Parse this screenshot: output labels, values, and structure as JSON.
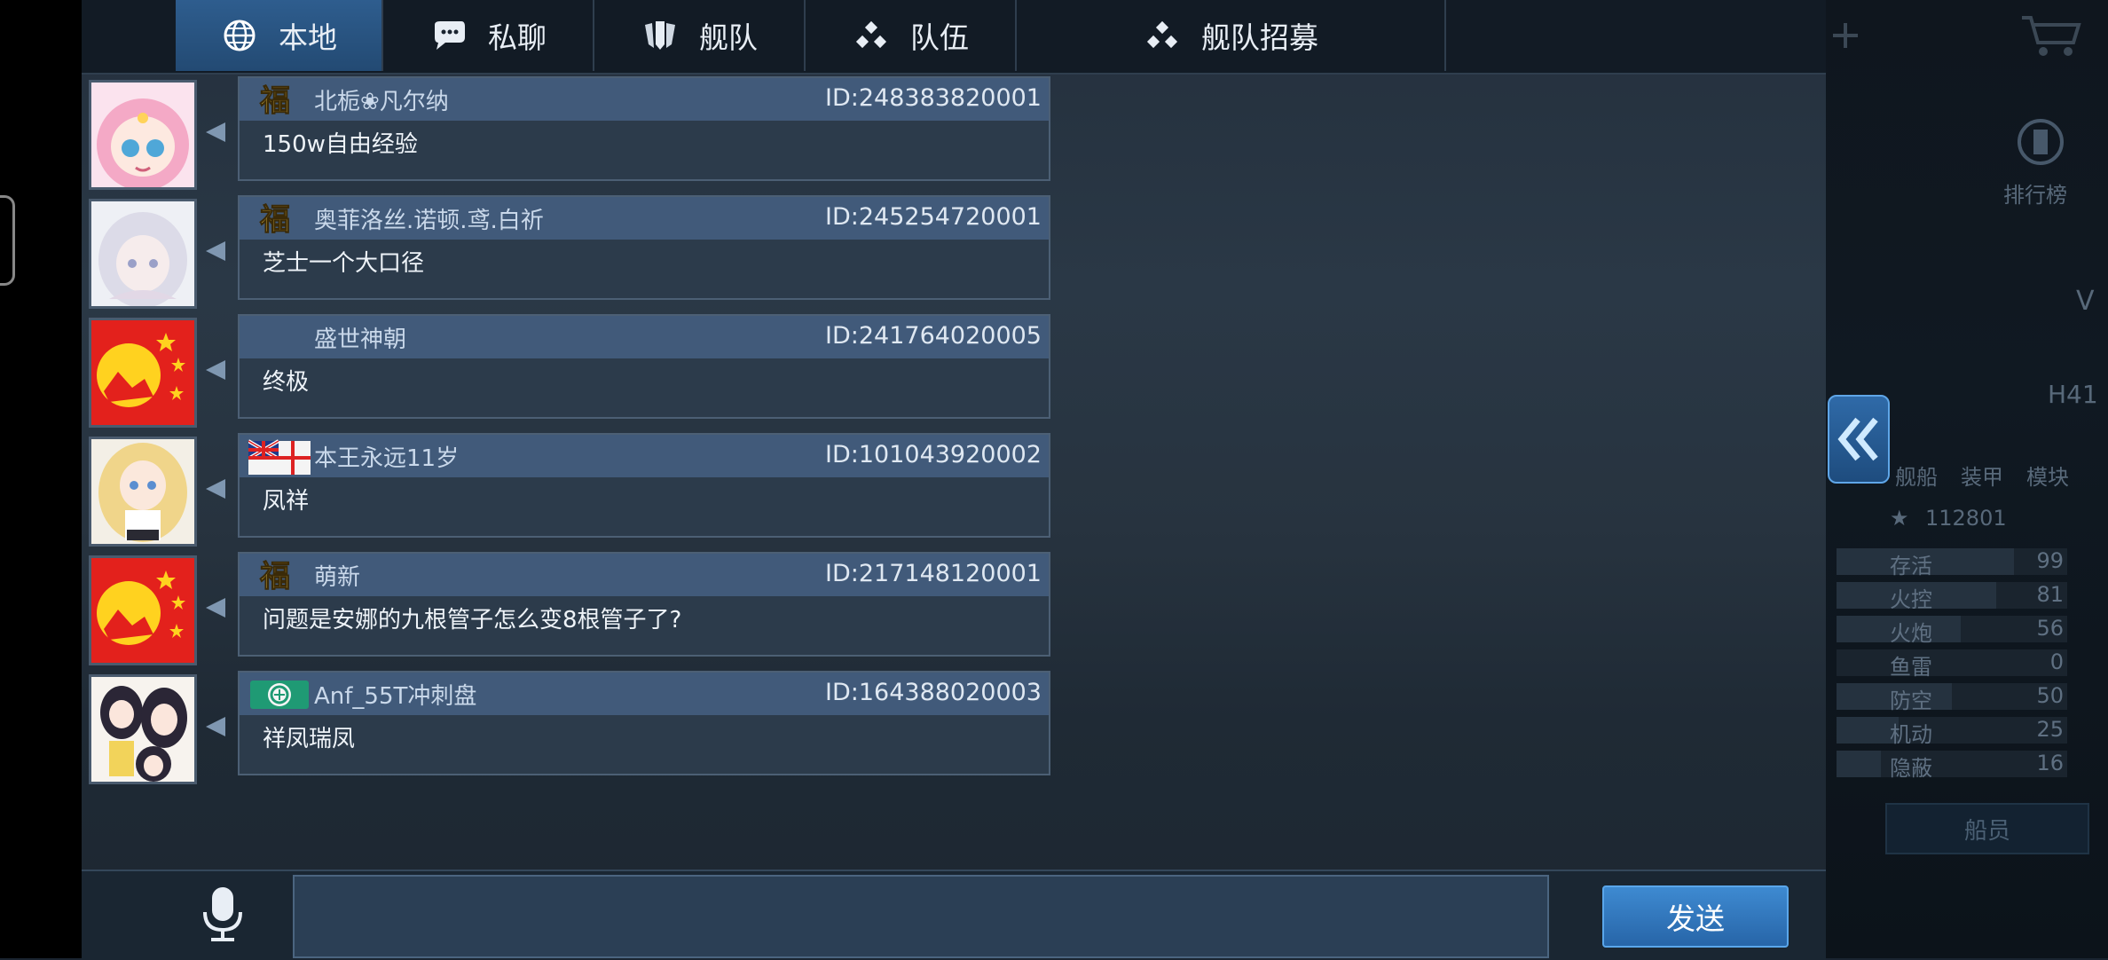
{
  "tabs": [
    {
      "label": "本地",
      "icon": "globe-icon",
      "active": true
    },
    {
      "label": "私聊",
      "icon": "chat-bubble-icon",
      "active": false
    },
    {
      "label": "舰队",
      "icon": "fleet-shield-icon",
      "active": false
    },
    {
      "label": "队伍",
      "icon": "team-dots-icon",
      "active": false
    },
    {
      "label": "舰队招募",
      "icon": "team-dots-icon",
      "active": false
    }
  ],
  "messages": [
    {
      "sender": "北栀❀凡尔纳",
      "id": "ID:248383820001",
      "text": "150w自由经验",
      "badge": "福",
      "avatar": "pink-hair-anime-avatar"
    },
    {
      "sender": "奥菲洛丝.诺顿.鸢.白祈",
      "id": "ID:245254720001",
      "text": "芝士一个大口径",
      "badge": "福",
      "avatar": "white-hair-anime-avatar"
    },
    {
      "sender": "盛世神朝",
      "id": "ID:241764020005",
      "text": "终极",
      "badge": "",
      "avatar": "red-star-emblem-avatar"
    },
    {
      "sender": "本王永远11岁",
      "id": "ID:101043920002",
      "text": "凤祥",
      "badge": "flag",
      "avatar": "blonde-anime-avatar"
    },
    {
      "sender": "萌新",
      "id": "ID:217148120001",
      "text": "问题是安娜的九根管子怎么变8根管子了?",
      "badge": "福",
      "avatar": "red-star-emblem-avatar"
    },
    {
      "sender": "Anf_55T冲刺盘",
      "id": "ID:164388020003",
      "text": "祥凤瑞凤",
      "badge": "green-emblem",
      "avatar": "dark-hair-anime-avatar"
    }
  ],
  "input": {
    "placeholder": "",
    "value": ""
  },
  "send_label": "发送",
  "right_panel": {
    "rank_label": "排行榜",
    "tier_letter": "V",
    "hull_code": "H41",
    "tabs": [
      "舰船",
      "装甲",
      "模块"
    ],
    "score": "112801",
    "stats": [
      {
        "name": "存活",
        "value": "99"
      },
      {
        "name": "火控",
        "value": "81"
      },
      {
        "name": "火炮",
        "value": "56"
      },
      {
        "name": "鱼雷",
        "value": "0"
      },
      {
        "name": "防空",
        "value": "50"
      },
      {
        "name": "机动",
        "value": "25"
      },
      {
        "name": "隐蔽",
        "value": "16"
      }
    ],
    "crew_label": "船员"
  },
  "colors": {
    "accent": "#2e5d8e",
    "send": "#2f77bd",
    "bubble_head": "#415a7a"
  }
}
